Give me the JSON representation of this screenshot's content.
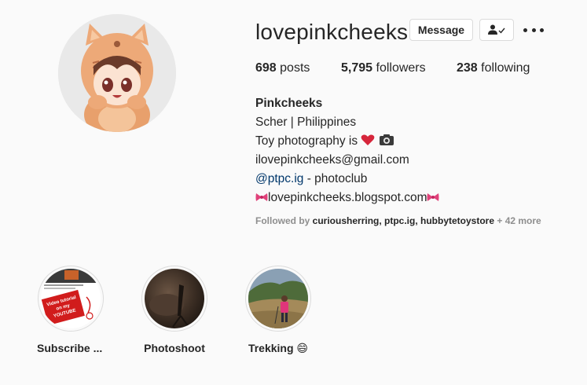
{
  "profile": {
    "username": "lovepinkcheeks",
    "message_label": "Message",
    "follow_icon": "person-check-icon",
    "more_icon": "more-options-icon"
  },
  "stats": {
    "posts_count": "698",
    "posts_label": "posts",
    "followers_count": "5,795",
    "followers_label": "followers",
    "following_count": "238",
    "following_label": "following"
  },
  "bio": {
    "name": "Pinkcheeks",
    "line1": "Scher | Philippines",
    "line2": "Toy photography is",
    "email": "ilovepinkcheeks@gmail.com",
    "mention": "@ptpc.ig",
    "mention_suffix": " - photoclub",
    "blog": "lovepinkcheeks.blogspot.com"
  },
  "followed_by": {
    "prefix": "Followed by ",
    "names": "curiousherring, ptpc.ig, hubbytetoystore",
    "more": " + 42 more"
  },
  "highlights": [
    {
      "label": "Subscribe ...",
      "thumb_text": "Video tutorial on my YOUTUBE channel!"
    },
    {
      "label": "Photoshoot"
    },
    {
      "label": "Trekking 😄"
    }
  ],
  "colors": {
    "background": "#fafafa",
    "text": "#262626",
    "muted": "#8e8e8e",
    "link": "#00376b",
    "border": "#dbdbdb"
  }
}
